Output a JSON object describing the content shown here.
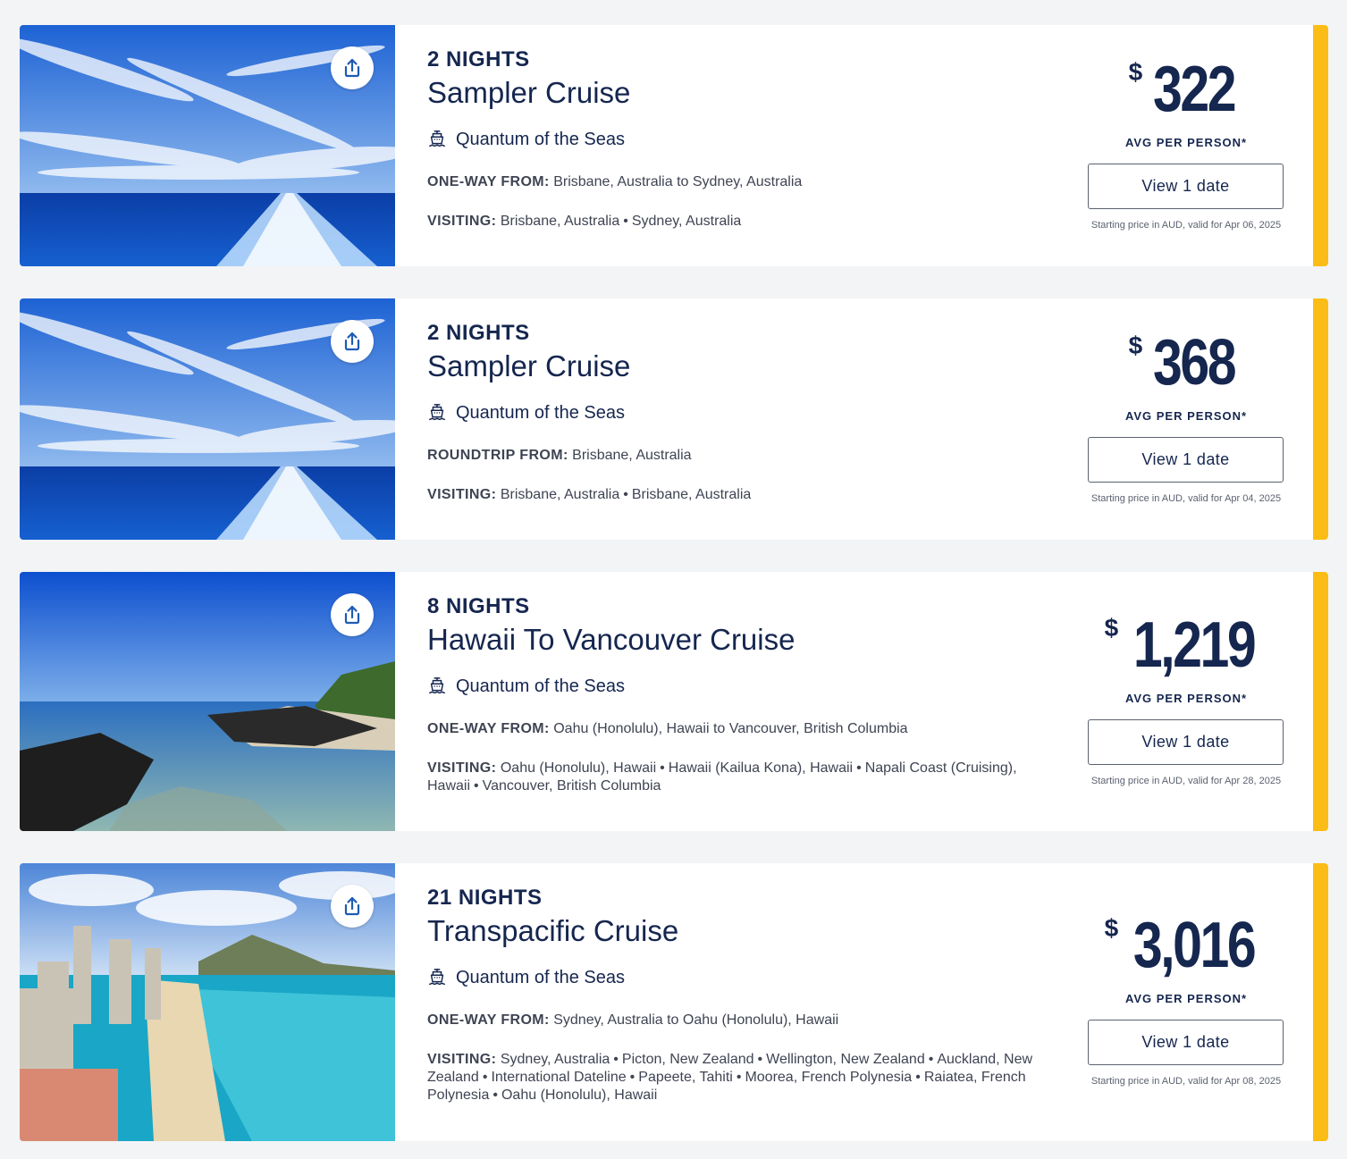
{
  "colors": {
    "accent": "#fbbc15",
    "navy": "#15264f",
    "text": "#3f4453"
  },
  "icons": {
    "share": "share-upload-icon",
    "ship": "ship-icon"
  },
  "cards": [
    {
      "nights": "2 NIGHTS",
      "title": "Sampler Cruise",
      "ship": "Quantum of the Seas",
      "from_label": "ONE-WAY FROM:",
      "from_value": "Brisbane, Australia to Sydney, Australia",
      "visiting_label": "VISITING:",
      "visiting": [
        "Brisbane, Australia",
        "Sydney, Australia"
      ],
      "currency": "$",
      "price": "322",
      "price_label": "AVG PER PERSON*",
      "button": "View 1 date",
      "note": "Starting price in AUD, valid for Apr 06, 2025",
      "image": "ocean-wake"
    },
    {
      "nights": "2 NIGHTS",
      "title": "Sampler Cruise",
      "ship": "Quantum of the Seas",
      "from_label": "ROUNDTRIP FROM:",
      "from_value": "Brisbane, Australia",
      "visiting_label": "VISITING:",
      "visiting": [
        "Brisbane, Australia",
        "Brisbane, Australia"
      ],
      "currency": "$",
      "price": "368",
      "price_label": "AVG PER PERSON*",
      "button": "View 1 date",
      "note": "Starting price in AUD, valid for Apr 04, 2025",
      "image": "ocean-wake"
    },
    {
      "nights": "8 NIGHTS",
      "title": "Hawaii To Vancouver Cruise",
      "ship": "Quantum of the Seas",
      "from_label": "ONE-WAY FROM:",
      "from_value": "Oahu (Honolulu), Hawaii to Vancouver, British Columbia",
      "visiting_label": "VISITING:",
      "visiting": [
        "Oahu (Honolulu), Hawaii",
        "Hawaii (Kailua Kona), Hawaii",
        "Napali Coast (Cruising), Hawaii",
        "Vancouver, British Columbia"
      ],
      "currency": "$",
      "price": "1,219",
      "price_label": "AVG PER PERSON*",
      "button": "View 1 date",
      "note": "Starting price in AUD, valid for Apr 28, 2025",
      "image": "lava-coast"
    },
    {
      "nights": "21 NIGHTS",
      "title": "Transpacific Cruise",
      "ship": "Quantum of the Seas",
      "from_label": "ONE-WAY FROM:",
      "from_value": "Sydney, Australia to Oahu (Honolulu), Hawaii",
      "visiting_label": "VISITING:",
      "visiting": [
        "Sydney, Australia",
        "Picton, New Zealand",
        "Wellington, New Zealand",
        "Auckland, New Zealand",
        "International Dateline",
        "Papeete, Tahiti",
        "Moorea, French Polynesia",
        "Raiatea, French Polynesia",
        "Oahu (Honolulu), Hawaii"
      ],
      "currency": "$",
      "price": "3,016",
      "price_label": "AVG PER PERSON*",
      "button": "View 1 date",
      "note": "Starting price in AUD, valid for Apr 08, 2025",
      "image": "waikiki"
    }
  ]
}
